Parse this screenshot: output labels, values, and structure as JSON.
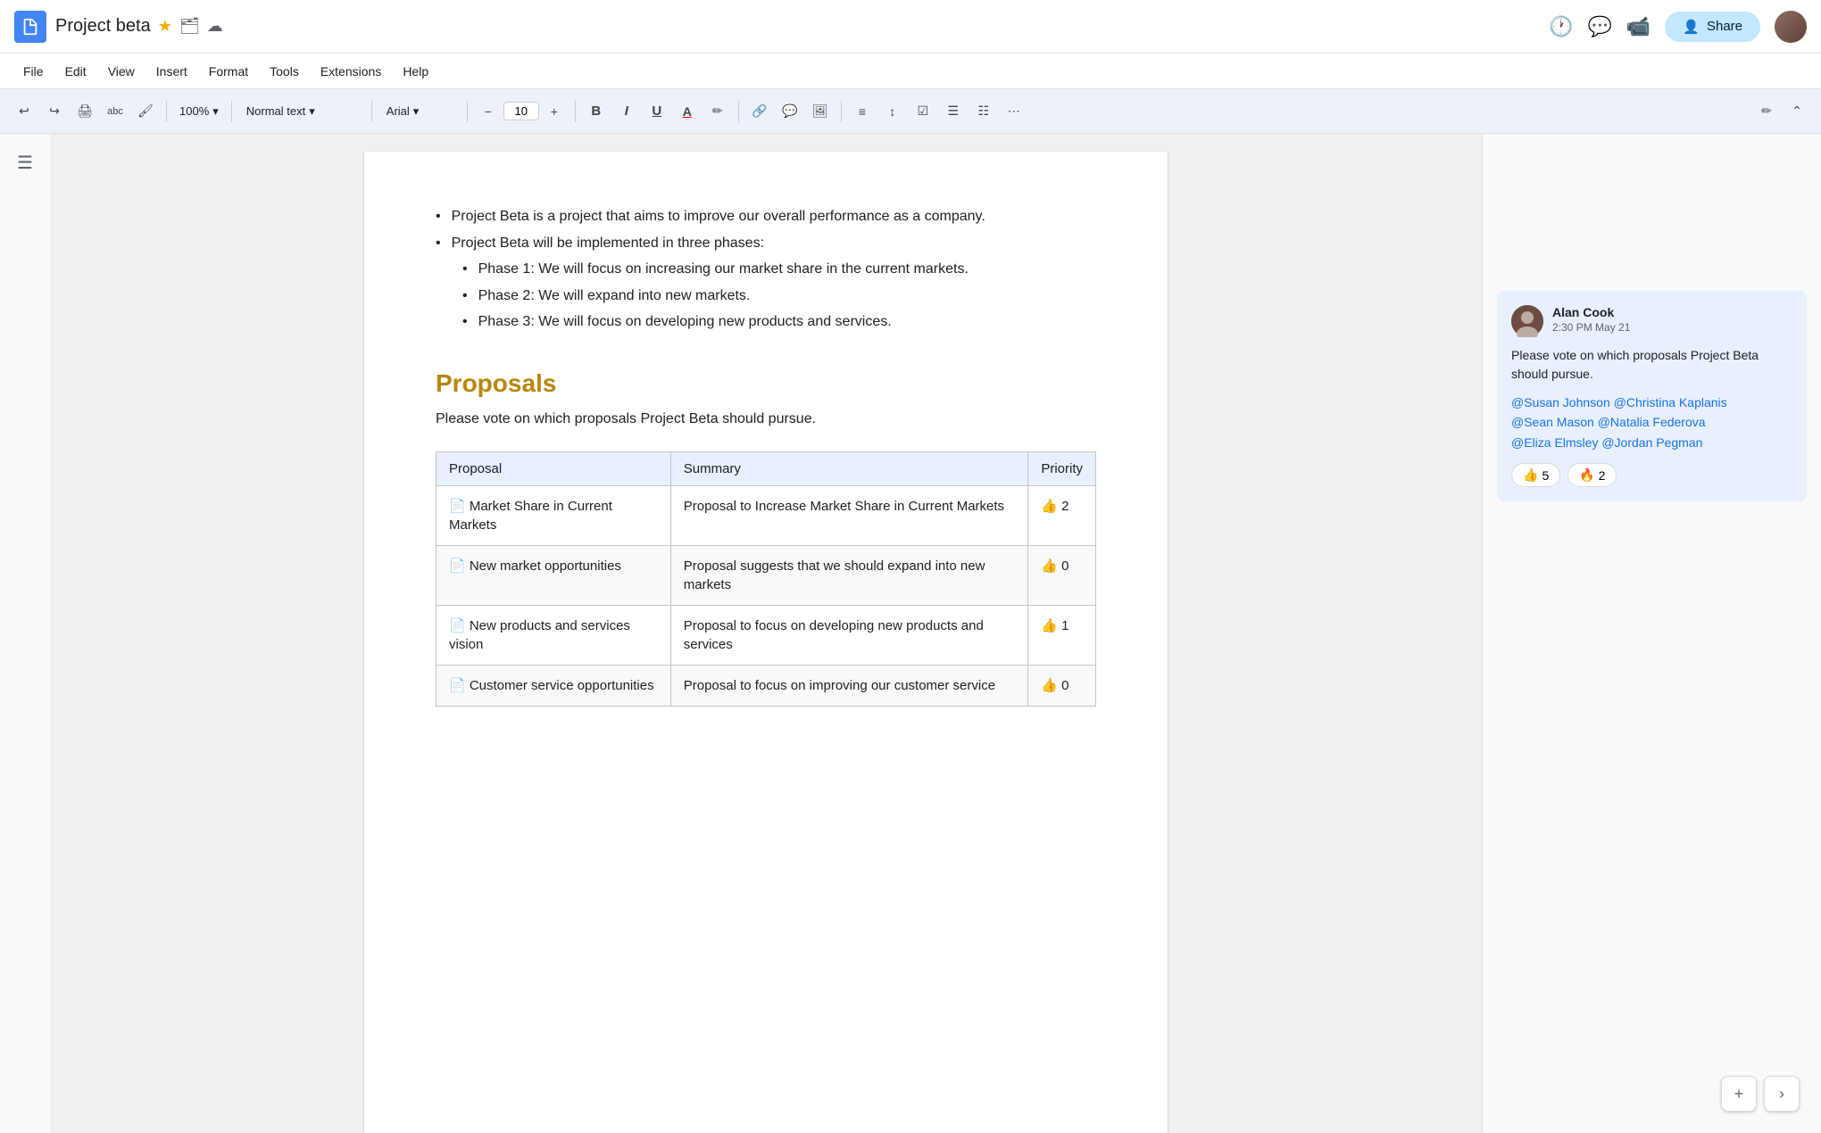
{
  "titleBar": {
    "docTitle": "Project beta",
    "starLabel": "★",
    "folderLabel": "🗂",
    "cloudLabel": "☁"
  },
  "menuBar": {
    "items": [
      "File",
      "Edit",
      "View",
      "Insert",
      "Format",
      "Tools",
      "Extensions",
      "Help"
    ]
  },
  "toolbar": {
    "undo": "↩",
    "redo": "↪",
    "print": "🖨",
    "spellcheck": "abc",
    "paintFormat": "🖌",
    "zoom": "100%",
    "zoomArrow": "▾",
    "styleText": "Normal text",
    "styleArrow": "▾",
    "fontName": "Arial",
    "fontArrow": "▾",
    "fontSizeMinus": "−",
    "fontSize": "10",
    "fontSizePlus": "+",
    "bold": "B",
    "italic": "I",
    "underline": "U",
    "textColor": "A",
    "highlight": "✏",
    "link": "🔗",
    "insertComment": "💬",
    "image": "🖼",
    "align": "≡",
    "lineSpacing": "↕",
    "checklist": "☑",
    "bulletList": "☰",
    "numberedList": "☷",
    "more": "⋯",
    "editPen": "✏",
    "collapse": "⌃"
  },
  "topRightIcons": {
    "history": "🕐",
    "comment": "💬",
    "video": "📹",
    "shareLabel": "Share"
  },
  "document": {
    "bullets": [
      {
        "text": "Project Beta is a project that aims to improve our overall performance as a company.",
        "level": 0
      },
      {
        "text": "Project Beta will be implemented in three phases:",
        "level": 0
      },
      {
        "text": "Phase 1: We will focus on increasing our market share in the current markets.",
        "level": 1
      },
      {
        "text": "Phase 2: We will expand into new markets.",
        "level": 1
      },
      {
        "text": "Phase 3: We will focus on developing new products and services.",
        "level": 1
      }
    ],
    "sectionHeading": "Proposals",
    "sectionDesc": "Please vote on which proposals Project Beta should pursue.",
    "table": {
      "headers": [
        "Proposal",
        "Summary",
        "Priority"
      ],
      "rows": [
        {
          "proposal": "📄 Market Share in Current Markets",
          "summary": "Proposal to Increase Market Share in Current Markets",
          "priority": "👍 2"
        },
        {
          "proposal": "📄 New market opportunities",
          "summary": "Proposal suggests that we should expand into new markets",
          "priority": "👍 0"
        },
        {
          "proposal": "📄 New products and services vision",
          "summary": "Proposal to focus on developing new products and services",
          "priority": "👍 1"
        },
        {
          "proposal": "📄 Customer service opportunities",
          "summary": "Proposal to focus on improving our customer service",
          "priority": "👍 0"
        }
      ]
    }
  },
  "comment": {
    "author": "Alan Cook",
    "time": "2:30 PM May 21",
    "body": "Please vote on which proposals Project Beta should pursue.",
    "mentions": "@Susan Johnson @Christina Kaplanis @Sean Mason @Natalia Federova @Eliza Elmsley @Jordan Pegman",
    "reactions": [
      {
        "emoji": "👍",
        "count": "5"
      },
      {
        "emoji": "🔥",
        "count": "2"
      }
    ]
  }
}
